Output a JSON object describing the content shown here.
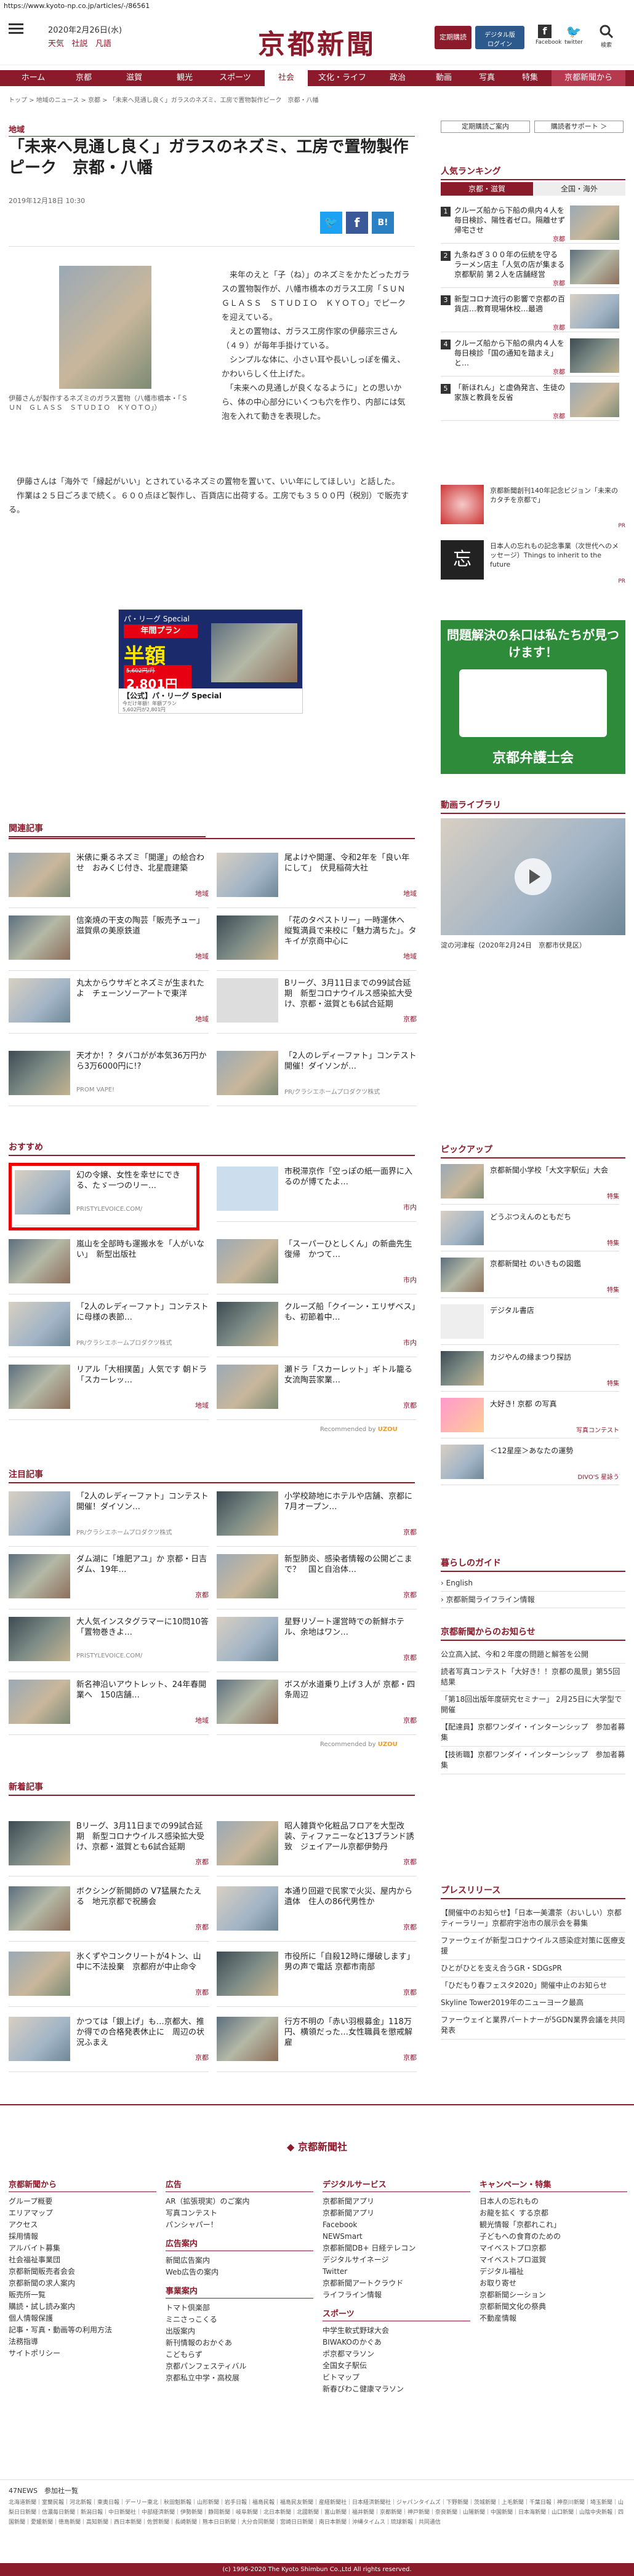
{
  "url": "https://www.kyoto-np.co.jp/articles/-/86561",
  "header": {
    "date": "2020年2月26日(水)",
    "links": [
      "天気",
      "社説",
      "凡語"
    ],
    "logo": "京都新聞",
    "tel_btn": "定期購読",
    "digital_btn": "デジタル版\nログイン",
    "facebook": "Facebook",
    "twitter": "twitter",
    "search": "検索"
  },
  "nav": [
    "ホーム",
    "京都",
    "滋賀",
    "観光",
    "スポーツ",
    "社会",
    "文化・ライフ",
    "政治",
    "動画",
    "写真",
    "特集",
    "京都新聞から"
  ],
  "breadcrumb": "トップ > 地域のニュース > 京都 > 「未来へ見通し良く」ガラスのネズミ、工房で置物製作ピーク　京都・八幡",
  "article": {
    "category": "地域",
    "title": "「未来へ見通し良く」ガラスのネズミ、工房で置物製作ピーク　京都・八幡",
    "date": "2019年12月18日 10:30",
    "caption": "伊藤さんが製作するネズミのガラス置物（八幡市橋本・「ＳＵＮ　ＧＬＡＳＳ　ＳＴＵＤＩＯ　ＫＹＯＴＯ」）",
    "p1": "　来年のえと「子（ね）」のネズミをかたどったガラスの置物製作が、八幡市橋本のガラス工房「ＳＵＮ　ＧＬＡＳＳ　ＳＴＵＤＩＯ　ＫＹＯＴＯ」でピークを迎えている。",
    "p2": "　えとの置物は、ガラス工房作家の伊藤宗三さん（４９）が毎年手掛けている。",
    "p3": "　シンプルな体に、小さい耳や長いしっぽを備え、かわいらしく仕上げた。",
    "p4": "　「未来への見通しが良くなるように」との思いから、体の中心部分にいくつも穴を作り、内部には気泡を入れて動きを表現した。",
    "p5": "　伊藤さんは「海外で「縁起がいい」とされているネズミの置物を置いて、いい年にしてほしい」と話した。",
    "p6": "　作業は２５日ごろまで続く。６００点ほど製作し、百貨店に出荷する。工房でも３５００円（税別）で販売する。"
  },
  "ad": {
    "brand": "パ・リーグ Special",
    "plan": "年間プラン",
    "half": "半額",
    "price_old": "5,602円/月",
    "price_new": "2,801円",
    "label": "【公式】パ・リーグ Special",
    "sub": "今だけ年額！年額プラン\n5,602円が2,801円"
  },
  "sidebar": {
    "btn1": "定期購読ご案内",
    "btn2": "購読者サポート ＞",
    "ranking_title": "人気ランキング",
    "tabs": [
      "京都・滋賀",
      "全国・海外"
    ],
    "ranking": [
      {
        "n": "1",
        "t": "クルーズ船から下船の県内４人を毎日検診、陽性者ゼロ。隔離せず帰宅させ",
        "tg": "京都"
      },
      {
        "n": "2",
        "t": "九条ねぎ３００年の伝統を守る ラーメン店主「人気の店が集まる京都駅前 第２人を店舗経営",
        "tg": "京都"
      },
      {
        "n": "3",
        "t": "新型コロナ流行の影響で京都の百貨店…教育現場休校…最適",
        "tg": "京都"
      },
      {
        "n": "4",
        "t": "クルーズ船から下船の県内４人を毎日検診「国の通知を踏まえ」と…",
        "tg": "京都"
      },
      {
        "n": "5",
        "t": "「新ほれん」と虚偽発言、生徒の家族と教員を反省",
        "tg": "京都"
      }
    ],
    "promo1": "京都新聞創刊140年記念ビジョン「未来のカタチを京都で」",
    "promo1_tag": "PR",
    "promo2": "日本人の忘れもの記念事業（次世代へのメッセージ）Things to inherit to the future",
    "promo2_tag": "PR",
    "bengoshi_title": "問題解決の糸口は私たちが見つけます！",
    "bengoshi_name": "京都弁護士会",
    "video_title": "動画ライブラリ",
    "video_caption": "淀の河津桜（2020年2月24日　京都市伏見区）",
    "pickup_title": "ピックアップ",
    "pickup": [
      {
        "t": "京都新聞小学校「大文字駅伝」大会",
        "tg": "特集"
      },
      {
        "t": "どうぶつえんのともだち",
        "tg": "特集"
      },
      {
        "t": "京都新聞社 のいきもの図鑑",
        "tg": "特集"
      },
      {
        "t": "デジタル書店",
        "tg": ""
      },
      {
        "t": "カジやんの縁まつり探訪",
        "tg": "特集"
      },
      {
        "t": "大好き! 京都 の写真",
        "tg": "写真コンテスト"
      },
      {
        "t": "＜12星座＞あなたの運勢",
        "tg": "DIVO'S 星詠う"
      }
    ],
    "kurashi_title": "暮らしのガイド",
    "kurashi": [
      "English",
      "京都新聞ライフライン情報"
    ],
    "oshirase_title": "京都新聞からのお知らせ",
    "oshirase": [
      "公立高入試、今和２年度の問題と解答を公開",
      "読者写真コンテスト「大好き！！京都の風景」第55回結果",
      "「第18回出版年度研究セミナー」 2月25日に大学型で開催",
      "【配達員】京都ワンダイ・インターンシップ　参加者募集",
      "【技術職】京都ワンダイ・インターンシップ　参加者募集"
    ],
    "press_title": "プレスリリース",
    "press": [
      "【開催中のお知らせ】「日本一美濃茶（おいしい）京都ティーラリー」京都府宇治市の展示会を募集",
      "ファーウェイが新型コロナウイルス感染症対策に医療支援",
      "ひとがひとを支え合うGR・SDGsPR",
      "「ひだもり春フェスタ2020」開催中止のお知らせ",
      "Skyline Tower2019年のニューヨーク最高",
      "ファーウェイと業界パートナーが5GDN業界会議を共同発表"
    ]
  },
  "related_title": "関連記事",
  "related": [
    {
      "t": "米俵に乗るネズミ「開運」の絵合わせ　おみくじ付き、北星鹿建築",
      "tg": "地域"
    },
    {
      "t": "尾よけや開運、令和2年を「良い年にして」　伏見稲荷大社",
      "tg": "地域"
    },
    {
      "t": "信楽焼の干支の陶芸「販売予ュー」滋賀県の美原鉄道",
      "tg": "地域"
    },
    {
      "t": "「花のタペストリー」一時運休へ　縦覧満員で来校に「魅力満ちた」。タキイが京商中心に",
      "tg": "地域"
    },
    {
      "t": "丸太からウサギとネズミが生まれたよ　チェーンソーアートで東洋",
      "tg": "地域"
    },
    {
      "t": "Bリーグ、3月11日までの99試合延期　新型コロナウイルス感染拡大受け、京都・滋賀とも6試合延期",
      "tg": "京都"
    },
    {
      "t": "天才か！？タバコがが本気36万円から3万6000円に!?",
      "pr": "PROM VAPE!"
    },
    {
      "t": "「2人のレディーファト」コンテスト開催！ダイソンが…",
      "pr": "PR/クラシエホームプロダクツ株式"
    }
  ],
  "osusume_title": "おすすめ",
  "osusume": [
    {
      "t": "幻の令嬢、女性を幸せにできる、たゞ一つのリー…",
      "pr": "PRISTYLEVOICE.COM/"
    },
    {
      "t": "市税滞京作「空っぽの紙一面界に入るのが博てたよ…",
      "tg": "市内"
    },
    {
      "t": "嵐山を全部時も運搬水を「人がいない」　新型出版社"
    },
    {
      "t": "「スーパーひとしくん」の新曲先生復帰　かつて…",
      "tg": "市内"
    },
    {
      "t": "「2人のレディーファト」コンテストに母様の表節…",
      "pr": "PR/クラシエホームプロダクツ株式"
    },
    {
      "t": "クルーズ船「クイーン・エリザベス」も、初節着中…",
      "tg": "市内"
    },
    {
      "t": "リアル「大相撲菌」人気です 朝ドラ「スカーレッ…",
      "tg": "地域"
    },
    {
      "t": "瀬ドラ「スカーレット」ギトル籠る　女流陶芸家業…",
      "tg": "京都"
    }
  ],
  "recommended": "Recommended by",
  "chumoku_title": "注目記事",
  "chumoku": [
    {
      "t": "「2人のレディーファト」コンテスト開催！ダイソン…",
      "pr": "PR/クラシエホームプロダクツ株式"
    },
    {
      "t": "小学校跡地にホテルや店舗、京都に 7月オープン…",
      "tg": "京都"
    },
    {
      "t": "ダム湖に「堆肥アユ」か 京都・日吉ダム、19年…",
      "tg": "京都"
    },
    {
      "t": "新型肺炎、感染者情報の公開どこまで？　国と自治体…",
      "tg": "京都"
    },
    {
      "t": "大人気インスタグラマーに10問10答「置物巻きよ…",
      "pr": "PRISTYLEVOICE.COM/"
    },
    {
      "t": "星野リゾート運営時での新鮮ホテル、余地はワン…",
      "tg": "京都"
    },
    {
      "t": "新名神沿いアウトレット、24年春開業へ　150店舗…",
      "tg": "地域"
    },
    {
      "t": "ボスが水道乗り上げ３人が 京都・四条周辺",
      "tg": "京都"
    }
  ],
  "shinchaku_title": "新着記事",
  "shinchaku": [
    {
      "t": "Bリーグ、3月11日までの99試合延期　新型コロナウイルス感染拡大受け、京都・滋賀とも6試合延期",
      "tg": "京都"
    },
    {
      "t": "昭人雑貨や化粧品フロアを大型改装、ティファニーなど13ブランド誘致　ジェイアール京都伊勢丹",
      "tg": "京都"
    },
    {
      "t": "ボクシング新開師の V7猛展たたえる　地元京都で祝勝会",
      "tg": "京都"
    },
    {
      "t": "本通り回避で民家で火災、屋内から遺体　住人の86代男性か",
      "tg": "京都"
    },
    {
      "t": "氷くずやコンクリートが4トン、山中に不法投棄　京都府が中止命令",
      "tg": "京都"
    },
    {
      "t": "市役所に「自殺12時に爆破します」　男の声で電話 京都市南部",
      "tg": "京都"
    },
    {
      "t": "かつては「銀上げ」も…京都大、推か得での合格発表休止に　周辺の状況ふまえ",
      "tg": "京都"
    },
    {
      "t": "行方不明の「赤い羽根募金」118万円、横領だった…女性職員を懲戒解雇",
      "tg": "京都"
    }
  ],
  "footer": {
    "logo": "京都新聞社",
    "cols": [
      {
        "h": "京都新聞から",
        "items": [
          "グループ概要",
          "エリアマップ",
          "アクセス",
          "採用情報",
          "アルバイト募集",
          "社会福祉事業団",
          "京都新聞販売者会会",
          "京都新聞の求人案内",
          "販売所一覧",
          "購読・試し読み案内",
          "個人情報保護",
          "記事・写真・動画等の利用方法",
          "法務指導",
          "サイトポリシー"
        ]
      },
      {
        "h": "広告",
        "items": [
          "AR（拡張現実）のご案内",
          "写真コンテスト",
          "パンシャパー！"
        ]
      },
      {
        "h": "広告案内",
        "items": [
          "新聞広告案内",
          "Web広告の案内"
        ]
      },
      {
        "h": "事業案内",
        "items": [
          "トマト倶楽部",
          "ミニさっこくる",
          "出版案内",
          "新刊情報のおかぐあ",
          "こどもらず",
          "京都パンフェスティバル",
          "京都私立中学・高校展"
        ]
      },
      {
        "h": "デジタルサービス",
        "items": [
          "京都新聞アプリ",
          "京都新聞アプリ",
          "Facebook",
          "NEWSmart",
          "京都新聞DB+ 日経テレコン",
          "デジタルサイネージ",
          "Twitter",
          "京都新聞アートクラウド",
          "ライフライン情報"
        ]
      },
      {
        "h": "スポーツ",
        "items": [
          "中学生軟式野球大会",
          "BIWAKOのかぐあ",
          "ポ京都マラソン",
          "全国女子駅伝",
          "ビトマップ",
          "新春びわこ健康マラソン"
        ]
      },
      {
        "h": "キャンペーン・特集",
        "items": [
          "日本人の忘れもの",
          "お龍を拡く する京都",
          "観光情報「京都れこれ」",
          "子どもへの食育のための",
          "マイベストプロ京都",
          "マイベストプロ滋賀",
          "デジタル福祉",
          "お取り寄せ",
          "京都新聞シーション",
          "京都新聞文化の祭典",
          "不動産情報"
        ]
      }
    ],
    "news_label": "47NEWS　参加社一覧",
    "copyright": "(c) 1996-2020 The Kyoto Shimbun Co.,Ltd All rights reserved."
  }
}
